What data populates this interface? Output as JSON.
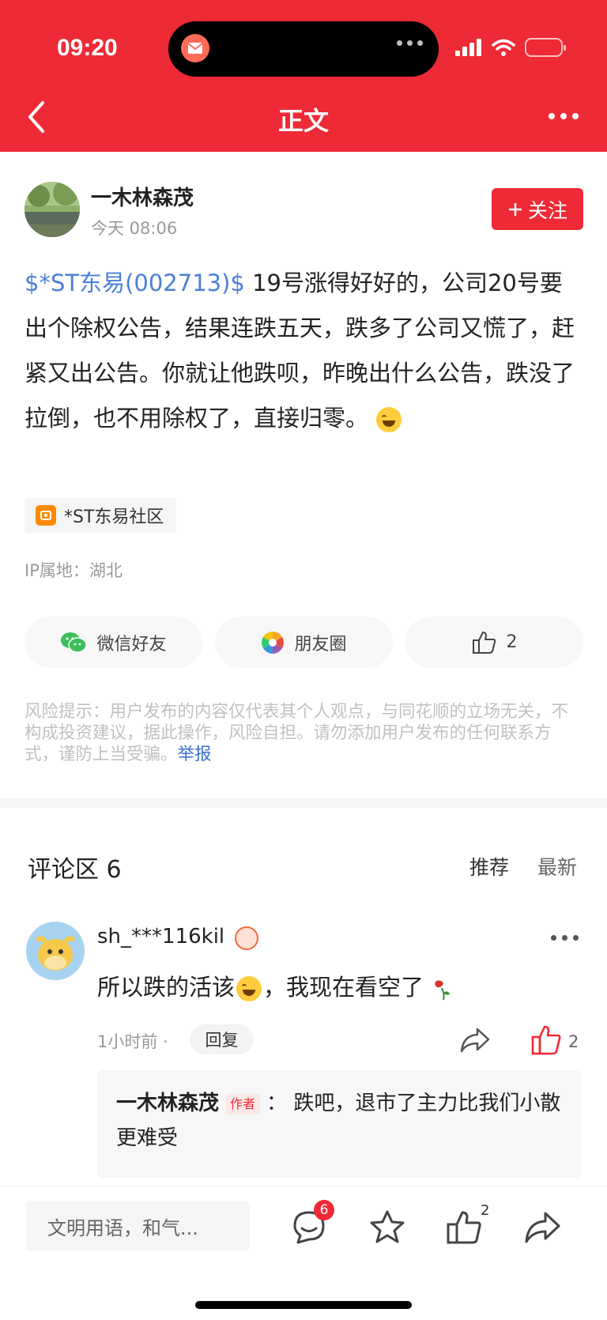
{
  "status_bar": {
    "time": "09:20"
  },
  "nav": {
    "title": "正文"
  },
  "post": {
    "author": "一木林森茂",
    "time": "今天 08:06",
    "follow_label": "关注",
    "stock_link": "$*ST东易(002713)$",
    "body": " 19号涨得好好的，公司20号要出个除权公告，结果连跌五天，跌多了公司又慌了，赶紧又出公告。你就让他跌呗，昨晚出什么公告，跌没了拉倒，也不用除权了，直接归零。",
    "community": "*ST东易社区",
    "ip_location": "IP属地：湖北"
  },
  "share": {
    "wechat_label": "微信好友",
    "moments_label": "朋友圈",
    "like_count": "2"
  },
  "risk": {
    "text": "风险提示：用户发布的内容仅代表其个人观点，与同花顺的立场无关，不构成投资建议，据此操作，风险自担。请勿添加用户发布的任何联系方式，谨防上当受骗。",
    "report_label": "举报"
  },
  "comments": {
    "title": "评论区 6",
    "sort_recommend": "推荐",
    "sort_latest": "最新",
    "items": [
      {
        "user": "sh_***116kil",
        "text": "所以跌的活该",
        "text_after": "，我现在看空了",
        "time": "1小时前 ·",
        "reply_label": "回复",
        "like_count": "2",
        "reply": {
          "author": "一木林森茂",
          "author_tag": "作者",
          "separator": "：",
          "text": "跌吧，退市了主力比我们小散更难受"
        }
      }
    ]
  },
  "bottom_bar": {
    "input_placeholder": "文明用语，和气...",
    "comment_badge": "6",
    "like_count": "2"
  },
  "colors": {
    "brand_red": "#ee2a36",
    "link_blue": "#4a7fd8"
  }
}
